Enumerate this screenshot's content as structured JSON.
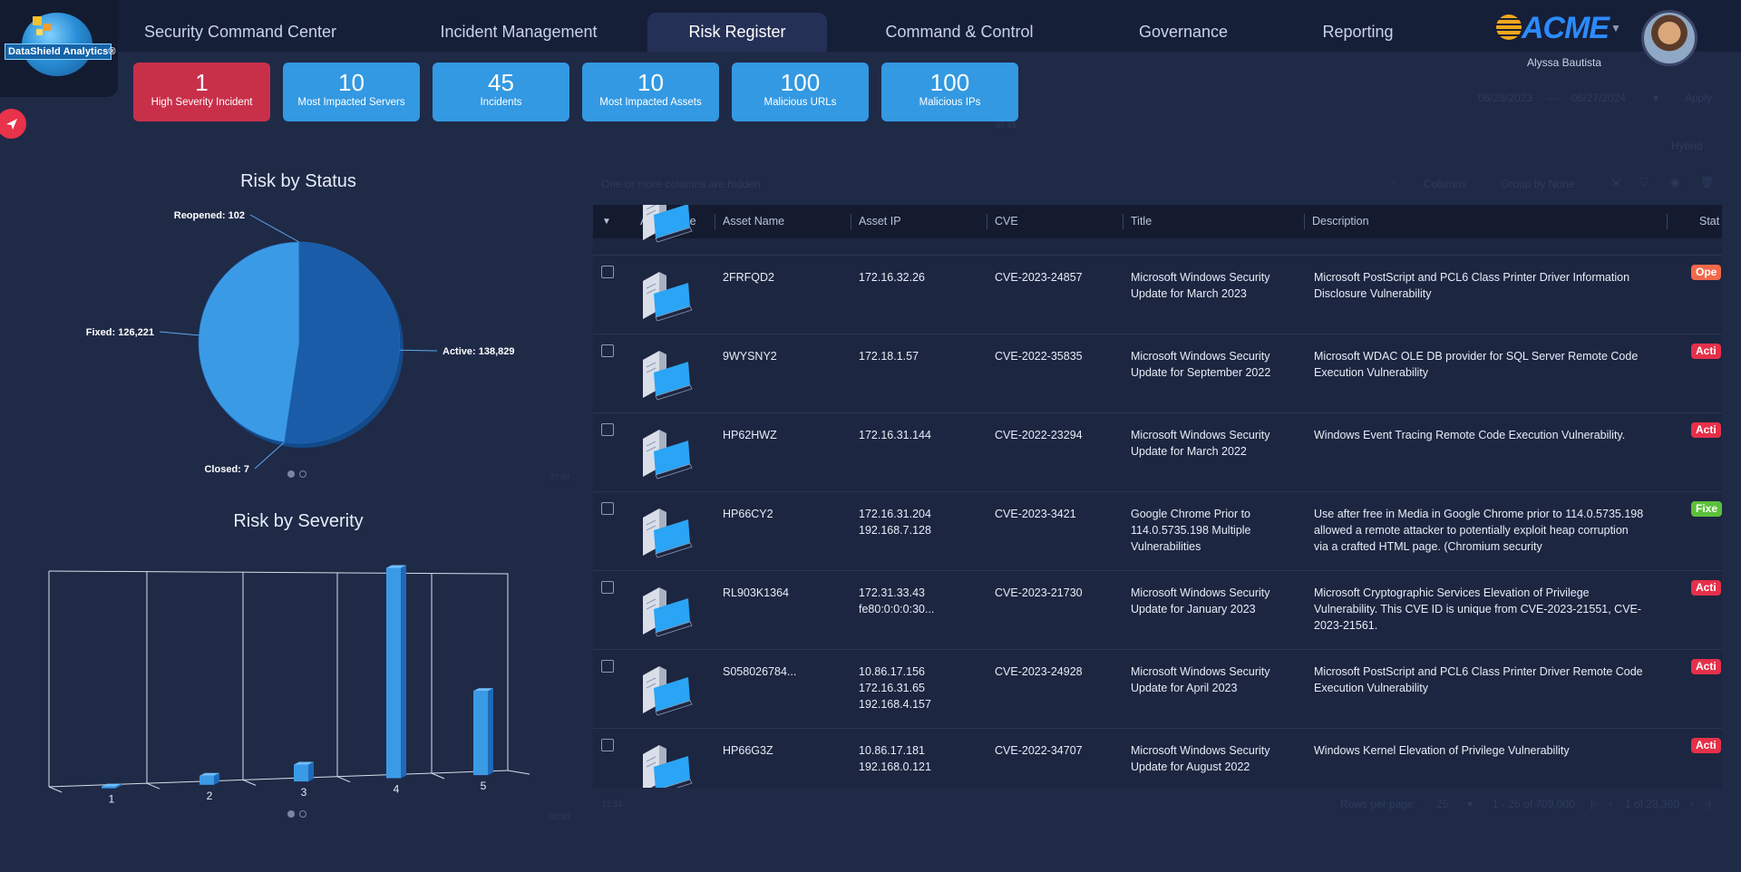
{
  "brand": {
    "logo_text": "DataShield Analytics®",
    "acme_text": "ACME",
    "user_name": "Alyssa Bautista"
  },
  "nav": {
    "tabs": [
      {
        "label": "Security Command Center"
      },
      {
        "label": "Incident Management"
      },
      {
        "label": "Risk Register"
      },
      {
        "label": "Command & Control"
      },
      {
        "label": "Governance"
      },
      {
        "label": "Reporting"
      }
    ],
    "active_tab": "Risk Register"
  },
  "cards": [
    {
      "value": "1",
      "label": "High Severity Incident",
      "color": "#c8304a"
    },
    {
      "value": "10",
      "label": "Most Impacted Servers",
      "color": "#3399e2"
    },
    {
      "value": "45",
      "label": "Incidents",
      "color": "#3399e2"
    },
    {
      "value": "10",
      "label": "Most Impacted Assets",
      "color": "#3399e2"
    },
    {
      "value": "100",
      "label": "Malicious URLs",
      "color": "#3399e2"
    },
    {
      "value": "100",
      "label": "Malicious IPs",
      "color": "#3399e2"
    }
  ],
  "controls": {
    "date_from": "06/28/2023",
    "date_sep": "—",
    "date_to": "06/27/2024",
    "apply": "Apply",
    "mode": "Hybrid",
    "hidden_note": "One or more columns are hidden",
    "columns_btn": "Columns",
    "group_by": "Group by None",
    "card_time": "07:48",
    "chart1_time": "07:50",
    "chart2_time": "00:20",
    "table_time": "12:51"
  },
  "chart_data": [
    {
      "type": "pie",
      "title": "Risk by Status",
      "slices": [
        {
          "label": "Active",
          "value": 138829
        },
        {
          "label": "Closed",
          "value": 7
        },
        {
          "label": "Fixed",
          "value": 126221
        },
        {
          "label": "Reopened",
          "value": 102
        }
      ],
      "data_labels": [
        "Active: 138,829",
        "Closed: 7",
        "Fixed: 126,221",
        "Reopened: 102"
      ],
      "colors": [
        "#1a5ca8",
        "#2a78c8",
        "#3b9ae6",
        "#2a78c8"
      ]
    },
    {
      "type": "bar",
      "title": "Risk by Severity",
      "categories": [
        "1",
        "2",
        "3",
        "4",
        "5"
      ],
      "values": [
        5,
        1300,
        2400,
        30000,
        12000
      ],
      "ylim": [
        0,
        30000
      ],
      "grid": true,
      "color": "#3b9ae6"
    }
  ],
  "table": {
    "columns": [
      "Asset Type",
      "Asset Name",
      "Asset IP",
      "CVE",
      "Title",
      "Description",
      "Stat"
    ],
    "rows": [
      {
        "name": "2FRFQD2",
        "ip": [
          "172.16.32.26"
        ],
        "cve": "CVE-2023-24857",
        "title": "Microsoft Windows Security Update for March 2023",
        "desc": "Microsoft PostScript and PCL6 Class Printer Driver Information Disclosure Vulnerability",
        "status": "Open",
        "status_shown": "Ope"
      },
      {
        "name": "9WYSNY2",
        "ip": [
          "172.18.1.57"
        ],
        "cve": "CVE-2022-35835",
        "title": "Microsoft Windows Security Update for September 2022",
        "desc": "Microsoft WDAC OLE DB provider for SQL Server Remote Code Execution Vulnerability",
        "status": "Active",
        "status_shown": "Acti"
      },
      {
        "name": "HP62HWZ",
        "ip": [
          "172.16.31.144"
        ],
        "cve": "CVE-2022-23294",
        "title": "Microsoft Windows Security Update for March 2022",
        "desc": "Windows Event Tracing Remote Code Execution Vulnerability.",
        "status": "Active",
        "status_shown": "Acti"
      },
      {
        "name": "HP66CY2",
        "ip": [
          "172.16.31.204",
          "192.168.7.128"
        ],
        "cve": "CVE-2023-3421",
        "title": "Google Chrome Prior to 114.0.5735.198 Multiple Vulnerabilities",
        "desc": "Use after free in Media in Google Chrome prior to 114.0.5735.198 allowed a remote attacker to potentially exploit heap corruption via a crafted HTML page. (Chromium security",
        "status": "Fixed",
        "status_shown": "Fixe"
      },
      {
        "name": "RL903K1364",
        "ip": [
          "172.31.33.43",
          "fe80:0:0:0:30..."
        ],
        "cve": "CVE-2023-21730",
        "title": "Microsoft Windows Security Update for January 2023",
        "desc": "Microsoft Cryptographic Services Elevation of Privilege Vulnerability. This CVE ID is unique from CVE-2023-21551, CVE-2023-21561.",
        "status": "Active",
        "status_shown": "Acti"
      },
      {
        "name": "S058026784...",
        "ip": [
          "10.86.17.156",
          "172.16.31.65",
          "192.168.4.157"
        ],
        "cve": "CVE-2023-24928",
        "title": "Microsoft Windows Security Update for April 2023",
        "desc": "Microsoft PostScript and PCL6 Class Printer Driver Remote Code Execution Vulnerability",
        "status": "Active",
        "status_shown": "Acti"
      },
      {
        "name": "HP66G3Z",
        "ip": [
          "10.86.17.181",
          "192.168.0.121"
        ],
        "cve": "CVE-2022-34707",
        "title": "Microsoft Windows Security Update for August 2022",
        "desc": "Windows Kernel Elevation of Privilege Vulnerability",
        "status": "Active",
        "status_shown": "Acti"
      }
    ]
  },
  "pagination": {
    "rows_per_page_label": "Rows per page:",
    "rows_per_page": "25",
    "range": "1 - 25 of 709,000",
    "pages": "1 of 28,360"
  },
  "icons": [
    "send-icon",
    "chevron-down-icon",
    "search-icon",
    "filter-icon",
    "eye-icon",
    "trash-icon",
    "server-icon"
  ]
}
